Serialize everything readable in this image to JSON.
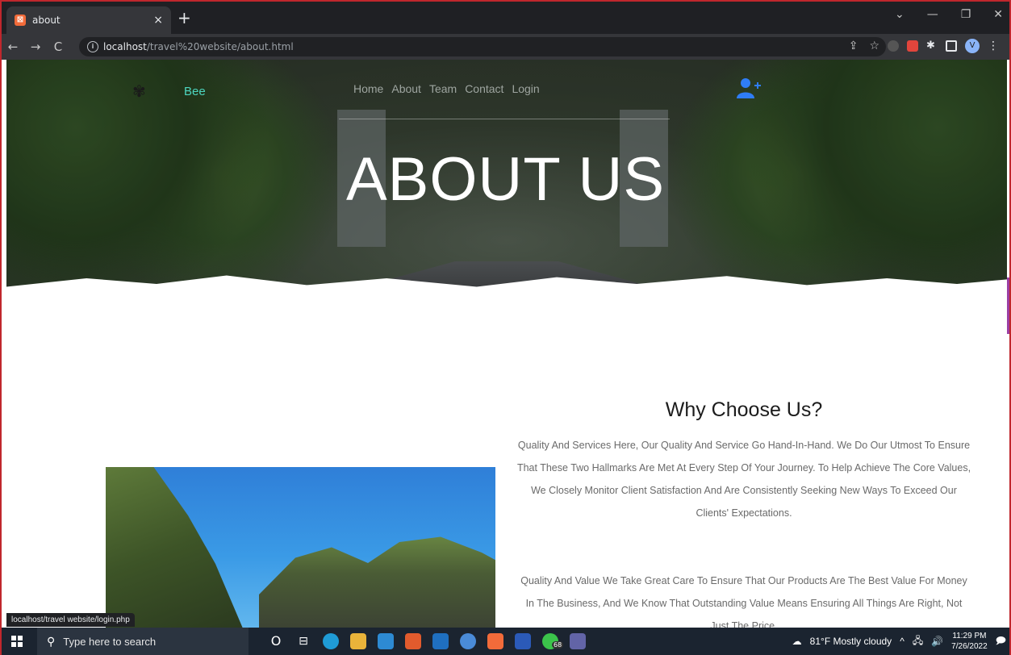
{
  "browser": {
    "tab_title": "about",
    "tab_close": "×",
    "new_tab": "+",
    "url_host": "localhost",
    "url_path": "/travel%20website/about.html",
    "status_url": "localhost/travel website/login.php"
  },
  "site": {
    "logo_text": "Bee",
    "nav": [
      "Home",
      "About",
      "Team",
      "Contact",
      "Login"
    ],
    "hero_title": "ABOUT US",
    "section_title": "Why Choose Us?",
    "paragraph_1": "Quality And Services Here, Our Quality And Service Go Hand-In-Hand. We Do Our Utmost To Ensure That These Two Hallmarks Are Met At Every Step Of Your Journey. To Help Achieve The Core Values, We Closely Monitor Client Satisfaction And Are Consistently Seeking New Ways To Exceed Our Clients' Expectations.",
    "paragraph_2": "Quality And Value We Take Great Care To Ensure That Our Products Are The Best Value For Money In The Business, And We Know That Outstanding Value Means Ensuring All Things Are Right, Not Just The Price."
  },
  "taskbar": {
    "search_placeholder": "Type here to search",
    "weather": "81°F  Mostly cloudy",
    "time": "11:29 PM",
    "date": "7/26/2022",
    "whatsapp_badge": "68"
  },
  "colors": {
    "accent": "#4dd6c0",
    "user_icon": "#2f7df6"
  }
}
